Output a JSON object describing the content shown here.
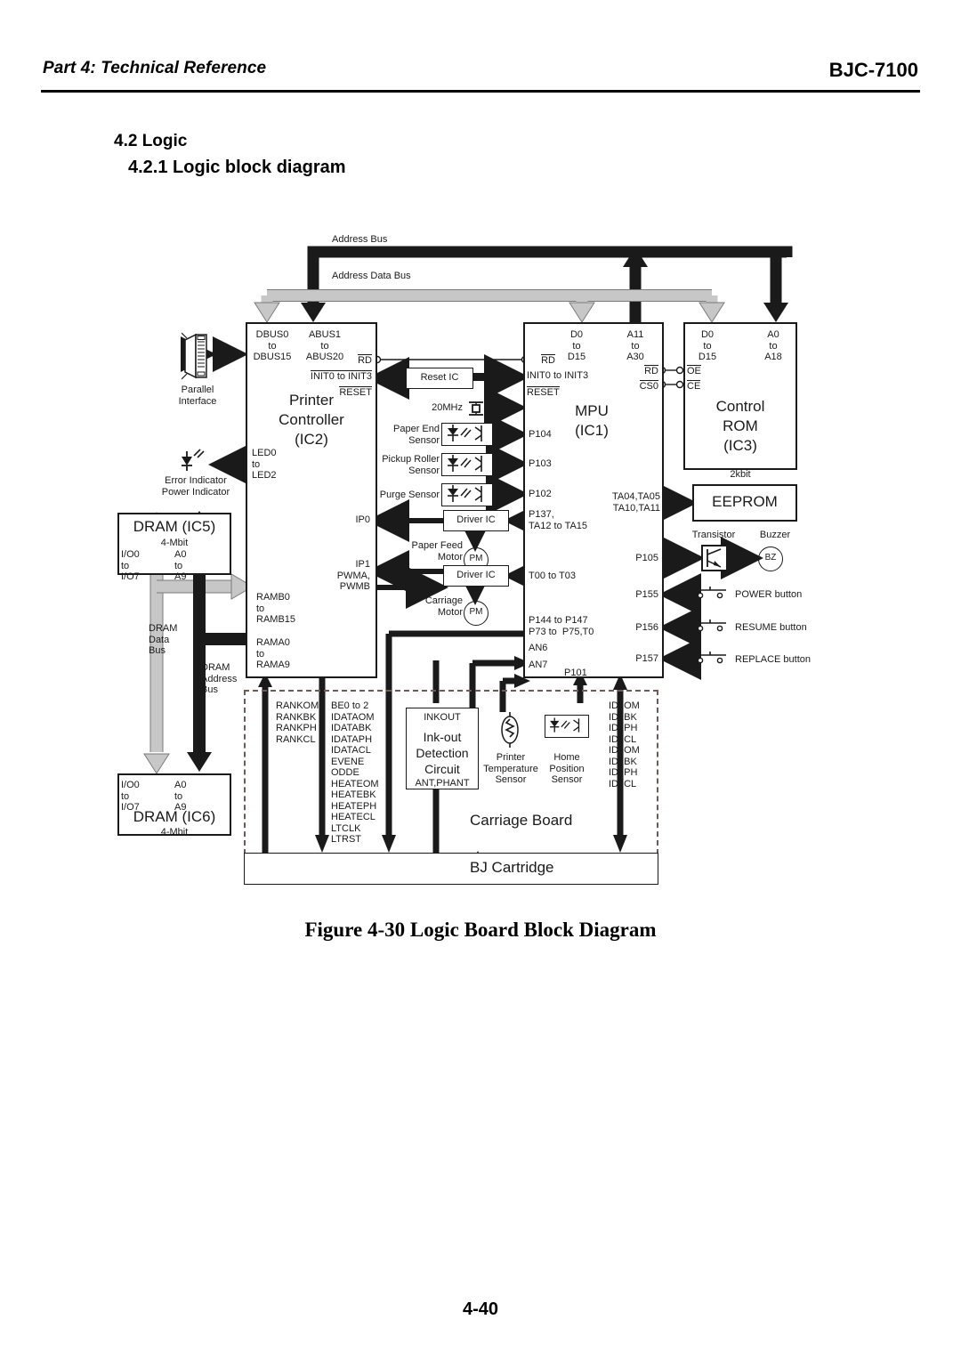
{
  "header": {
    "left": "Part 4: Technical Reference",
    "right": "BJC-7100"
  },
  "headings": {
    "section": "4.2 Logic",
    "subsection": "4.2.1 Logic block diagram"
  },
  "figure": {
    "caption": "Figure 4-30 Logic Board Block Diagram"
  },
  "footer": {
    "page_number": "4-40"
  },
  "diagram": {
    "buses": {
      "address_bus": "Address Bus",
      "address_data_bus": "Address Data Bus",
      "dram_data_bus": "DRAM\nData\nBus",
      "dram_address_bus": "DRAM\nAddress\nBus"
    },
    "blocks": {
      "printer_controller": {
        "title": "Printer",
        "title2": "Controller",
        "id": "(IC2)",
        "pins": {
          "dbus": "DBUS0\nto\nDBUS15",
          "abus": "ABUS1\nto\nABUS20",
          "rd": "RD",
          "init": "INIT0 to INIT3",
          "reset": "RESET",
          "led": "LED0\nto\nLED2",
          "ip0": "IP0",
          "ip1": "IP1\nPWMA,\nPWMB",
          "ramb": "RAMB0\nto\nRAMB15",
          "rama": "RAMA0\nto\nRAMA9"
        }
      },
      "mpu": {
        "title": "MPU",
        "id": "(IC1)",
        "pins": {
          "d": "D0\nto\nD15",
          "a": "A11\nto\nA30",
          "rd_left": "RD",
          "init": "INIT0 to INIT3",
          "reset": "RESET",
          "rd_right": "RD",
          "cs0": "CS0",
          "p104": "P104",
          "p103": "P103",
          "p102": "P102",
          "p137": "P137,\nTA12 to TA15",
          "t00": "T00 to T03",
          "p144": "P144 to P147\nP73 to  P75,T0",
          "an6": "AN6",
          "an7": "AN7",
          "p101": "P101",
          "ta04": "TA04,TA05\nTA10,TA11",
          "p105": "P105",
          "p155": "P155",
          "p156": "P156",
          "p157": "P157"
        }
      },
      "control_rom": {
        "title": "Control",
        "title2": "ROM",
        "id": "(IC3)",
        "pins": {
          "d": "D0\nto\nD15",
          "a": "A0\nto\nA18",
          "oe": "OE",
          "ce": "CE"
        }
      },
      "eeprom": {
        "title": "EEPROM",
        "capacity": "2kbit"
      },
      "dram_ic5": {
        "title": "DRAM (IC5)",
        "capacity": "4-Mbit",
        "io": "I/O0\nto\nI/O7",
        "addr": "A0\nto\nA9"
      },
      "dram_ic6": {
        "title": "DRAM (IC6)",
        "capacity": "4-Mbit",
        "io": "I/O0\nto\nI/O7",
        "addr": "A0\nto\nA9"
      },
      "reset_ic": "Reset IC",
      "driver_ic_1": "Driver IC",
      "driver_ic_2": "Driver IC",
      "ink_out": {
        "top_pin": "INKOUT",
        "title": "Ink-out",
        "title2": "Detection",
        "title3": "Circuit",
        "bottom_pin": "ANT,PHANT"
      },
      "carriage_board": "Carriage Board",
      "bj_cartridge": "BJ Cartridge"
    },
    "peripherals": {
      "parallel_interface": "Parallel\nInterface",
      "indicators": "Error Indicator\nPower Indicator",
      "oscillator": "20MHz",
      "paper_end_sensor": "Paper End\nSensor",
      "pickup_roller_sensor": "Pickup Roller\nSensor",
      "purge_sensor": "Purge Sensor",
      "paper_feed_motor": "Paper Feed\nMotor",
      "carriage_motor": "Carriage\nMotor",
      "motor_symbol": "PM",
      "transistor": "Transistor",
      "buzzer": "Buzzer",
      "buzzer_symbol": "BZ",
      "power_button": "POWER button",
      "resume_button": "RESUME button",
      "replace_button": "REPLACE button",
      "printer_temperature_sensor": "Printer\nTemperature\nSensor",
      "home_position_sensor": "Home\nPosition\nSensor"
    },
    "signal_groups": {
      "rank": "RANKOM\nRANKBK\nRANKPH\nRANKCL",
      "data": "BE0 to 2\nIDATAOM\nIDATABK\nIDATAPH\nIDATACL\nEVENE\nODDE\nHEATEOM\nHEATEBK\nHEATEPH\nHEATECL\nLTCLK\nLTRST",
      "id": "ID1OM\nID1BK\nID1PH\nID1CL\nID2OM\nID2BK\nID2PH\nID2CL"
    }
  },
  "colors": {
    "ink": "#1a1a1a",
    "data_bus_gray": "#c7c7c7",
    "dashed_border": "#6b5b5b"
  }
}
